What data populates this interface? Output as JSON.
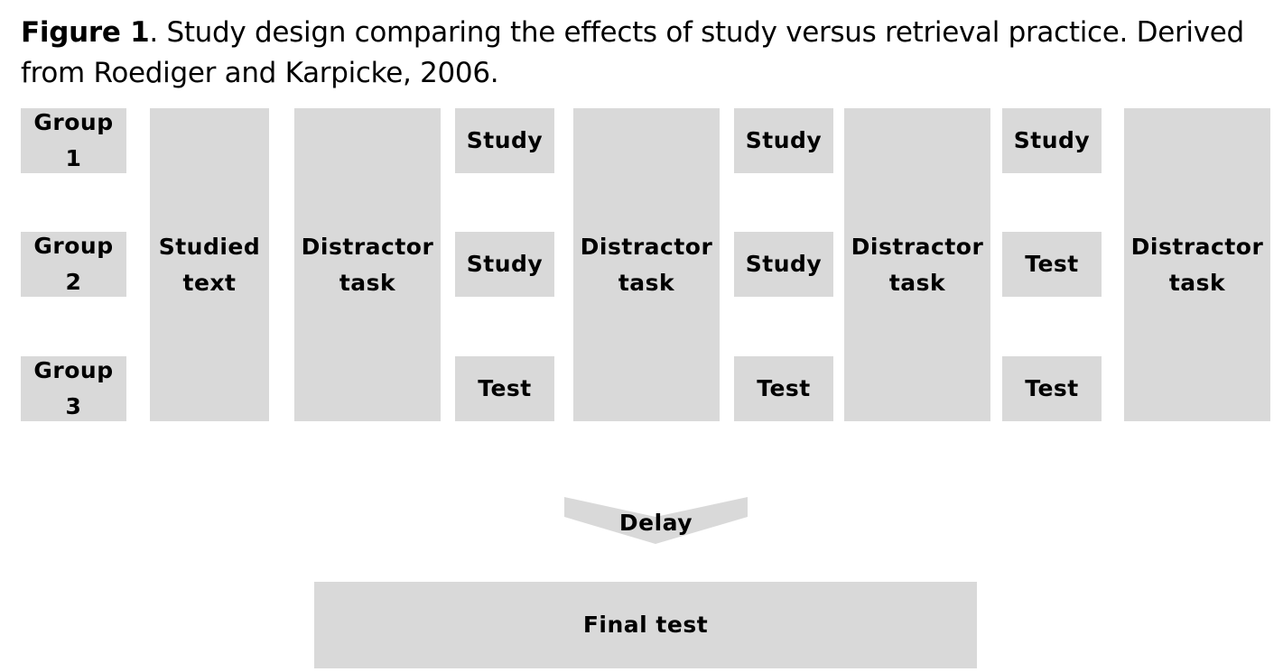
{
  "caption": {
    "label": "Figure 1",
    "text": ". Study design comparing the effects of study versus retrieval practice. Derived from Roediger and Karpicke, 2006."
  },
  "groups": [
    {
      "line1": "Group",
      "line2": "1"
    },
    {
      "line1": "Group",
      "line2": "2"
    },
    {
      "line1": "Group",
      "line2": "3"
    }
  ],
  "studied_text": {
    "line1": "Studied",
    "line2": "text"
  },
  "distractor": {
    "line1": "Distractor",
    "line2": "task"
  },
  "phases": [
    {
      "group1": "Study",
      "group2": "Study",
      "group3": "Test"
    },
    {
      "group1": "Study",
      "group2": "Study",
      "group3": "Test"
    },
    {
      "group1": "Study",
      "group2": "Test",
      "group3": "Test"
    }
  ],
  "delay": {
    "label": "Delay"
  },
  "final_test": {
    "label": "Final test"
  },
  "colors": {
    "box_fill": "#d9d9d9",
    "text": "#000000",
    "background": "#ffffff"
  }
}
